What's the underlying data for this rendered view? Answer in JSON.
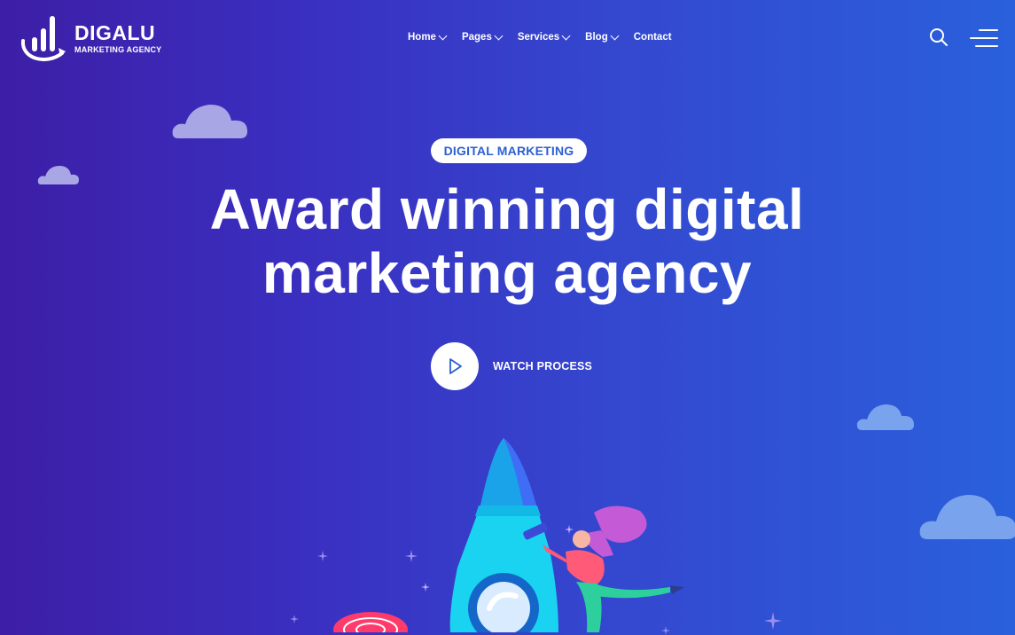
{
  "brand": {
    "name": "DIGALU",
    "tagline": "MARKETING AGENCY"
  },
  "nav": {
    "items": [
      {
        "label": "Home",
        "dropdown": true
      },
      {
        "label": "Pages",
        "dropdown": true
      },
      {
        "label": "Services",
        "dropdown": true
      },
      {
        "label": "Blog",
        "dropdown": true
      },
      {
        "label": "Contact",
        "dropdown": false
      }
    ]
  },
  "hero": {
    "badge": "DIGITAL MARKETING",
    "title_line1": "Award winning digital",
    "title_line2": "marketing agency",
    "watch_label": "WATCH PROCESS"
  },
  "icons": {
    "search": "search-icon",
    "menu": "hamburger-menu-icon",
    "play": "play-icon"
  },
  "colors": {
    "accent": "#2c5fd3",
    "bg_left": "#3d1ea6",
    "bg_right": "#2a60dc",
    "cloud": "#a9a6e6",
    "rocket": "#19d3f0"
  }
}
